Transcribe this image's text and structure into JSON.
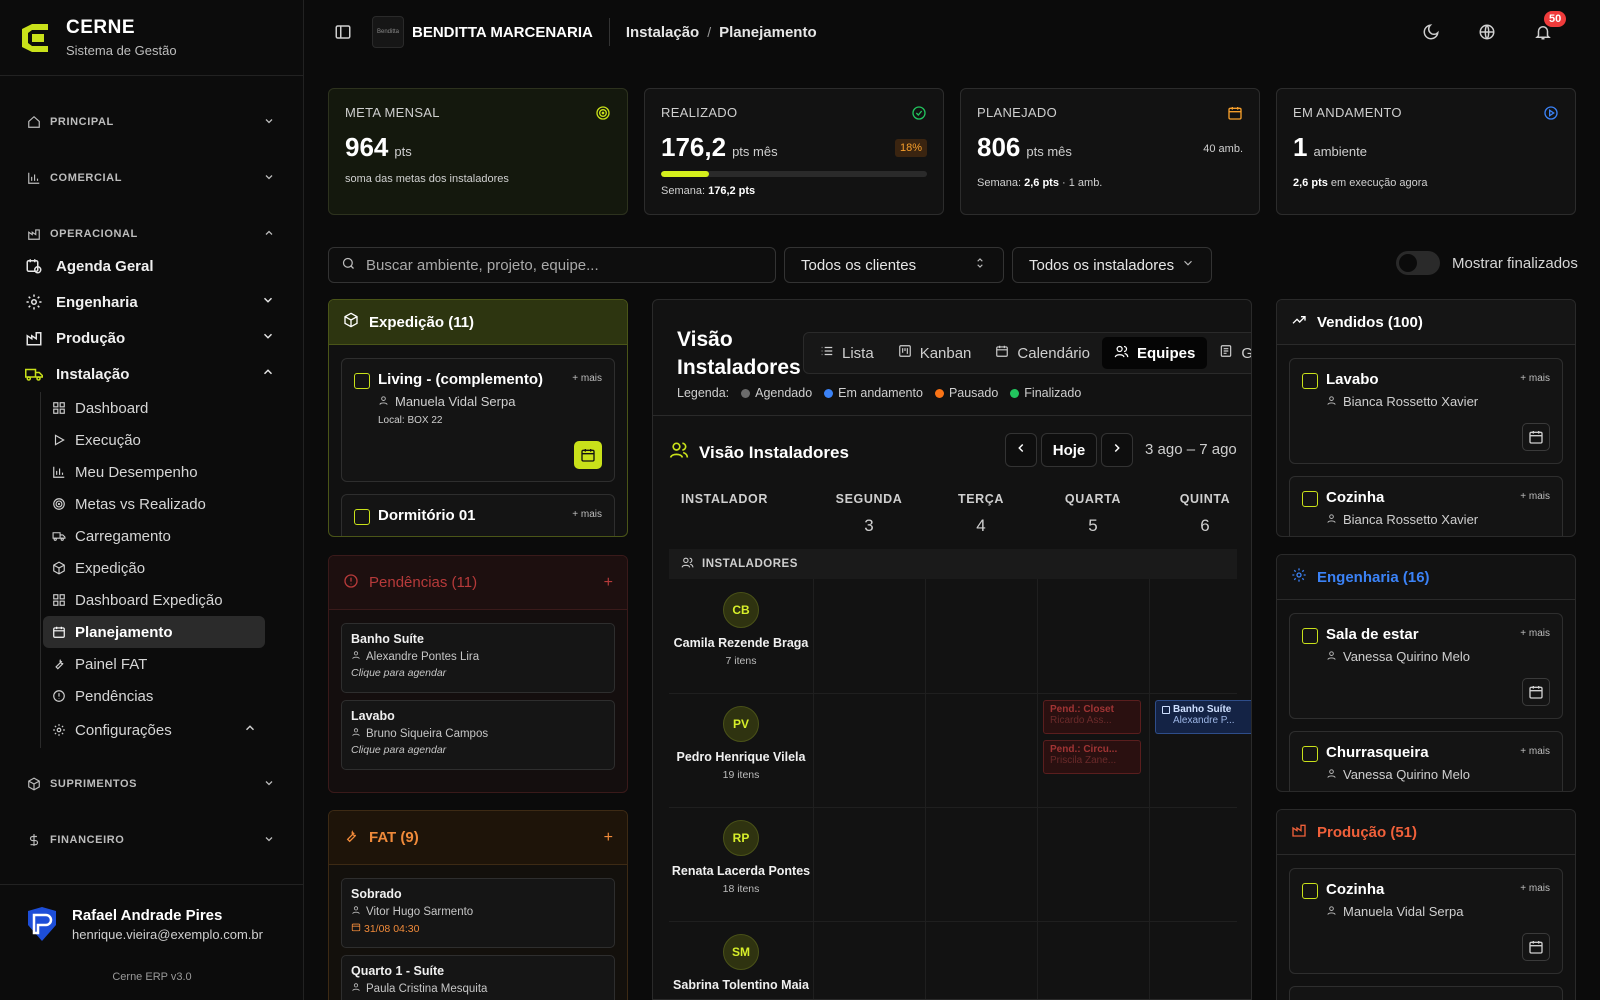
{
  "brand": {
    "name": "CERNE",
    "subtitle": "Sistema de Gestão"
  },
  "sidebar": {
    "sections": {
      "principal": "PRINCIPAL",
      "comercial": "COMERCIAL",
      "operacional": "OPERACIONAL",
      "suprimentos": "SUPRIMENTOS",
      "financeiro": "FINANCEIRO"
    },
    "items": {
      "agenda": "Agenda Geral",
      "engenharia": "Engenharia",
      "producao": "Produção",
      "instalacao": "Instalação"
    },
    "sub": [
      "Dashboard",
      "Execução",
      "Meu Desempenho",
      "Metas vs Realizado",
      "Carregamento",
      "Expedição",
      "Dashboard Expedição",
      "Planejamento",
      "Painel FAT",
      "Pendências",
      "Configurações"
    ],
    "active": "Planejamento"
  },
  "user": {
    "name": "Rafael Andrade Pires",
    "email": "henrique.vieira@exemplo.com.br",
    "version": "Cerne ERP v3.0"
  },
  "topbar": {
    "company": "BENDITTA MARCENARIA",
    "company_logo": "Benditta",
    "breadcrumb": [
      "Instalação",
      "Planejamento"
    ],
    "notifications": "50"
  },
  "kpis": {
    "meta": {
      "title": "META MENSAL",
      "value": "964",
      "unit": "pts",
      "sub": "soma das metas dos instaladores"
    },
    "realizado": {
      "title": "REALIZADO",
      "value": "176,2",
      "unit": "pts mês",
      "pct": "18%",
      "progress": 0.18,
      "week_label": "Semana:",
      "week_value": "176,2 pts"
    },
    "planejado": {
      "title": "PLANEJADO",
      "value": "806",
      "unit": "pts mês",
      "right": "40 amb.",
      "week_label": "Semana:",
      "week_value": "2,6 pts",
      "week_rest": "· 1 amb."
    },
    "andamento": {
      "title": "EM ANDAMENTO",
      "value": "1",
      "unit": "ambiente",
      "sub_bold": "2,6 pts",
      "sub_rest": "em execução agora"
    }
  },
  "filters": {
    "search_placeholder": "Buscar ambiente, projeto, equipe...",
    "clientes": "Todos os clientes",
    "instaladores": "Todos os instaladores",
    "toggle": "Mostrar finalizados"
  },
  "expedicao": {
    "title": "Expedição (11)",
    "cards": [
      {
        "title": "Living - (complemento)",
        "more": "+ mais",
        "person": "Manuela Vidal Serpa",
        "local": "Local: BOX 22"
      },
      {
        "title": "Dormitório 01",
        "more": "+ mais"
      }
    ]
  },
  "pendencias": {
    "title": "Pendências (11)",
    "plus": "+",
    "cards": [
      {
        "title": "Banho Suíte",
        "person": "Alexandre Pontes Lira",
        "hint": "Clique para agendar"
      },
      {
        "title": "Lavabo",
        "person": "Bruno Siqueira Campos",
        "hint": "Clique para agendar"
      }
    ]
  },
  "fat": {
    "title": "FAT (9)",
    "plus": "+",
    "cards": [
      {
        "title": "Sobrado",
        "person": "Vitor Hugo Sarmento",
        "date": "31/08 04:30"
      },
      {
        "title": "Quarto 1 - Suíte",
        "person": "Paula Cristina Mesquita"
      }
    ]
  },
  "center": {
    "title_l1": "Visão",
    "title_l2": "Instaladores",
    "tabs": [
      "Lista",
      "Kanban",
      "Calendário",
      "Equipes",
      "Ga"
    ],
    "active_tab": "Equipes",
    "legend_label": "Legenda:",
    "legend": [
      {
        "label": "Agendado",
        "color": "#6b6b6b"
      },
      {
        "label": "Em andamento",
        "color": "#3b82f6"
      },
      {
        "label": "Pausado",
        "color": "#f97316"
      },
      {
        "label": "Finalizado",
        "color": "#22c55e"
      }
    ],
    "section_title": "Visão Instaladores",
    "today": "Hoje",
    "range": "3 ago – 7 ago",
    "col_installer": "INSTALADOR",
    "days": [
      {
        "name": "SEGUNDA",
        "num": "3"
      },
      {
        "name": "TERÇA",
        "num": "4"
      },
      {
        "name": "QUARTA",
        "num": "5"
      },
      {
        "name": "QUINTA",
        "num": "6"
      }
    ],
    "group": "INSTALADORES",
    "installers": [
      {
        "initials": "CB",
        "name": "Camila Rezende Braga",
        "items": "7 itens"
      },
      {
        "initials": "PV",
        "name": "Pedro Henrique Vilela",
        "items": "19 itens"
      },
      {
        "initials": "RP",
        "name": "Renata Lacerda Pontes",
        "items": "18 itens"
      },
      {
        "initials": "SM",
        "name": "Sabrina Tolentino Maia",
        "items": ""
      }
    ],
    "events": [
      {
        "title": "Pend.: Closet",
        "person": "Ricardo Ass..."
      },
      {
        "title": "Pend.: Circu...",
        "person": "Priscila Zane..."
      },
      {
        "title": "Banho Suíte",
        "person": "Alexandre P..."
      }
    ]
  },
  "vendidos": {
    "title": "Vendidos (100)",
    "cards": [
      {
        "title": "Lavabo",
        "more": "+ mais",
        "person": "Bianca Rossetto Xavier"
      },
      {
        "title": "Cozinha",
        "more": "+ mais",
        "person": "Bianca Rossetto Xavier"
      }
    ]
  },
  "engenharia": {
    "title": "Engenharia (16)",
    "cards": [
      {
        "title": "Sala de estar",
        "more": "+ mais",
        "person": "Vanessa Quirino Melo"
      },
      {
        "title": "Churrasqueira",
        "more": "+ mais",
        "person": "Vanessa Quirino Melo"
      }
    ]
  },
  "producao": {
    "title": "Produção (51)",
    "cards": [
      {
        "title": "Cozinha",
        "more": "+ mais",
        "person": "Manuela Vidal Serpa"
      }
    ]
  },
  "colors": {
    "accent": "#c9e11a",
    "pend": "#e5484d",
    "fat": "#f08a3a",
    "eng": "#3b82f6",
    "prod": "#f0603a"
  }
}
